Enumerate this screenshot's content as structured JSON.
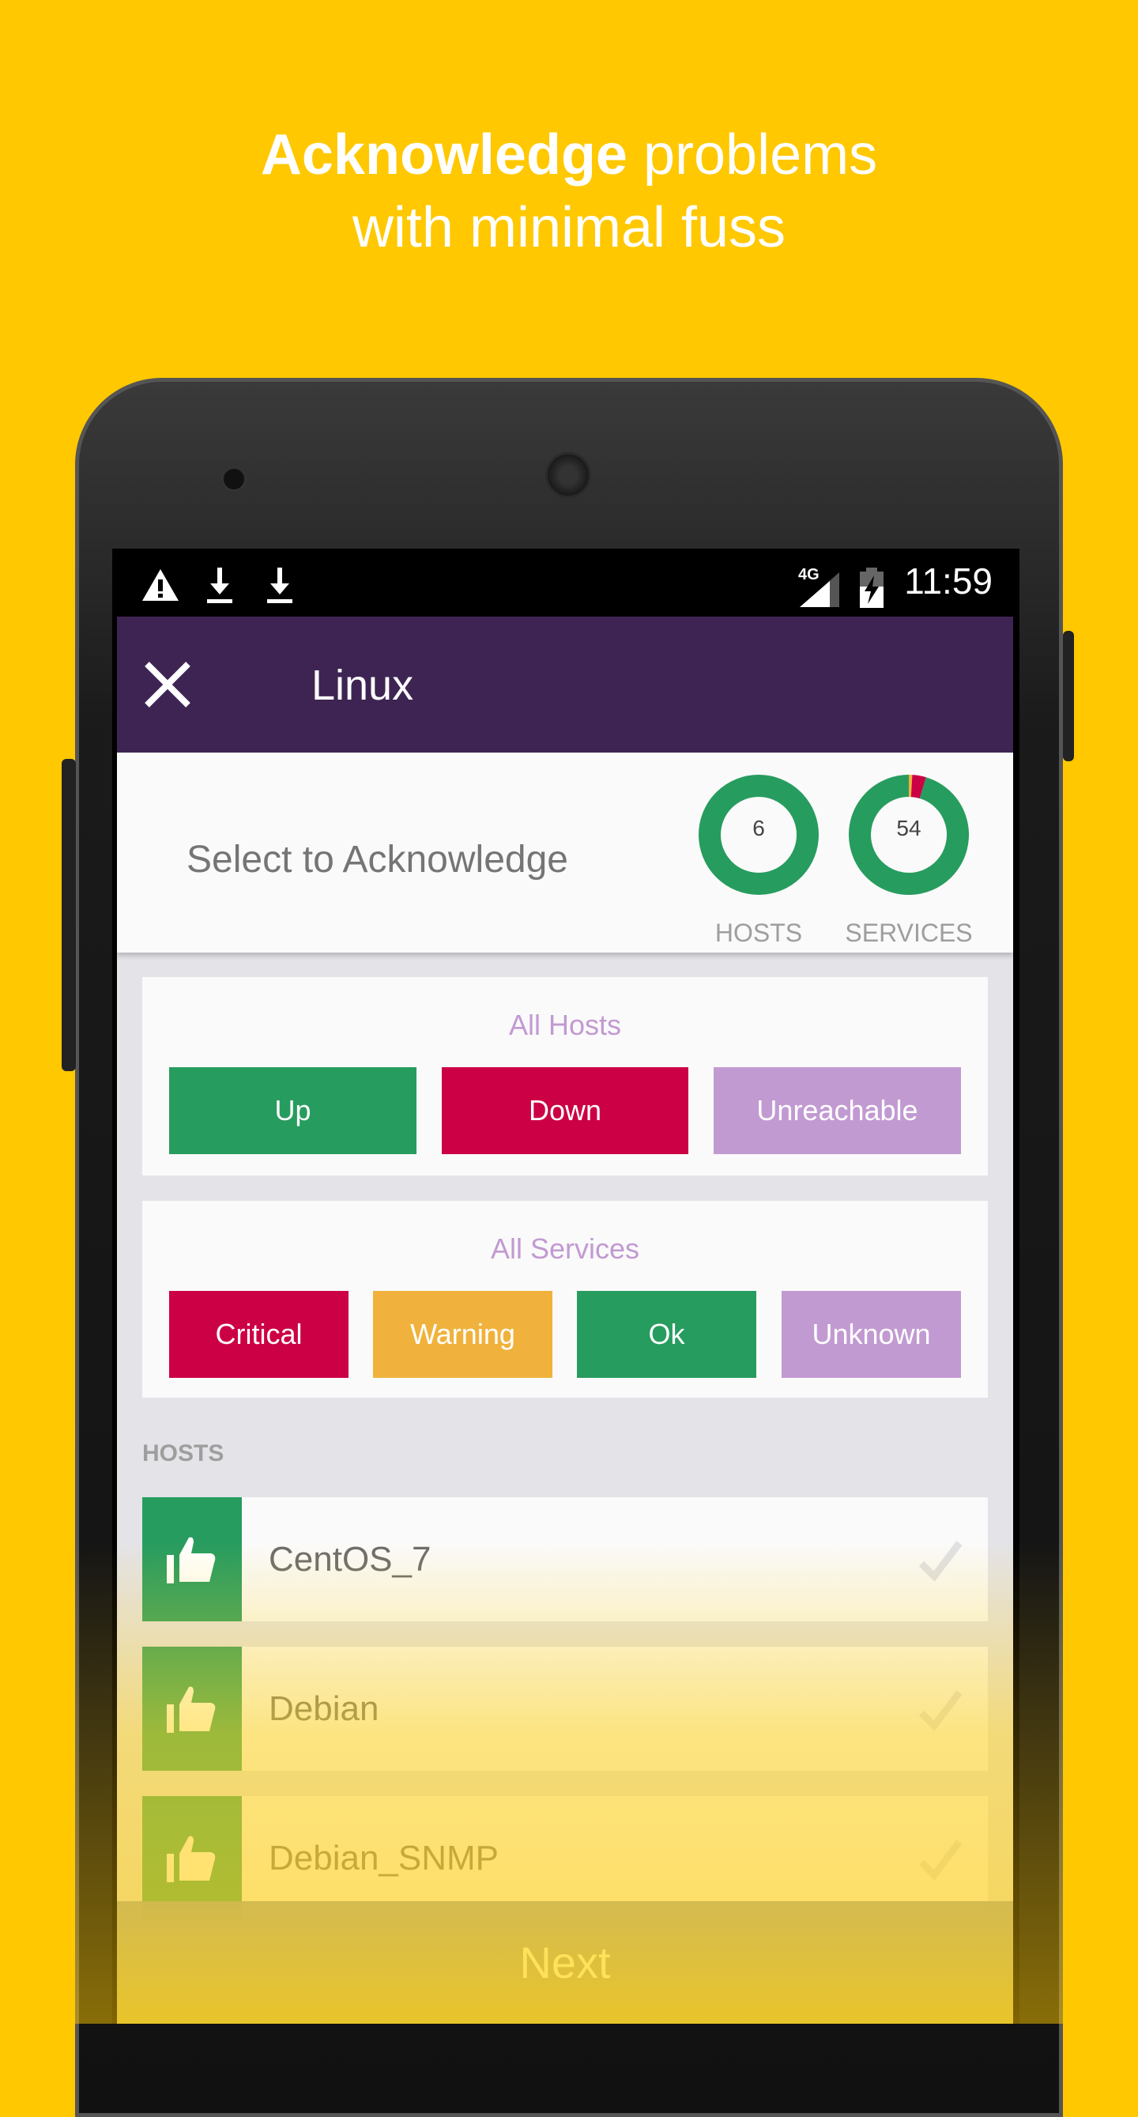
{
  "headline": {
    "bold": "Acknowledge",
    "rest": " problems",
    "line2": "with minimal fuss"
  },
  "status_bar": {
    "icons": [
      "warning-icon",
      "download-icon",
      "download-icon",
      "signal-4g-icon",
      "battery-charging-icon"
    ],
    "network": "4G",
    "time": "11:59"
  },
  "appbar": {
    "title": "Linux",
    "close_icon": "close-icon"
  },
  "header": {
    "label": "Select to Acknowledge",
    "hosts": {
      "count": "6",
      "label": "HOSTS",
      "segments": [
        {
          "state": "up",
          "value": 6,
          "color": "#279c5f"
        }
      ]
    },
    "services": {
      "count": "54",
      "label": "SERVICES",
      "segments": [
        {
          "state": "ok",
          "value": 51.5,
          "color": "#279c5f"
        },
        {
          "state": "warning",
          "value": 0.5,
          "color": "#f0b23c"
        },
        {
          "state": "critical",
          "value": 2,
          "color": "#cc0044"
        }
      ]
    }
  },
  "all_hosts": {
    "title": "All Hosts",
    "buttons": [
      {
        "label": "Up",
        "color": "#279c5f"
      },
      {
        "label": "Down",
        "color": "#cc0044"
      },
      {
        "label": "Unreachable",
        "color": "#c29ad2"
      }
    ]
  },
  "all_services": {
    "title": "All Services",
    "buttons": [
      {
        "label": "Critical",
        "color": "#cc0044"
      },
      {
        "label": "Warning",
        "color": "#f0b23c"
      },
      {
        "label": "Ok",
        "color": "#279c5f"
      },
      {
        "label": "Unknown",
        "color": "#c29ad2"
      }
    ]
  },
  "hosts_section": {
    "label": "HOSTS",
    "items": [
      {
        "name": "CentOS_7",
        "icon": "thumbs-up-icon",
        "status_color": "#279c5f"
      },
      {
        "name": "Debian",
        "icon": "thumbs-up-icon",
        "status_color": "#279c5f"
      },
      {
        "name": "Debian_SNMP",
        "icon": "thumbs-up-icon",
        "status_color": "#279c5f"
      }
    ]
  },
  "next_label": "Next",
  "colors": {
    "background": "#ffc800",
    "appbar": "#3e2453"
  }
}
